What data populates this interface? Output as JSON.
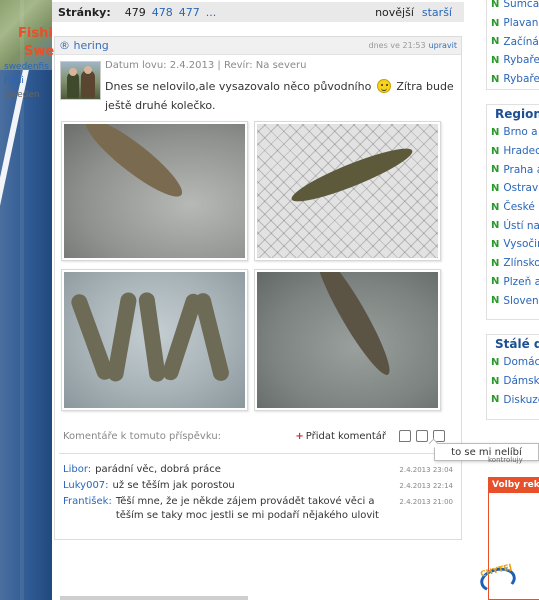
{
  "pager": {
    "label": "Stránky:",
    "current": "479",
    "pages": [
      "478",
      "477",
      "..."
    ],
    "newer": "novější",
    "older": "starší"
  },
  "post": {
    "author": "hering",
    "time": "dnes ve 21:53",
    "edit": "upravit",
    "meta": "Datum lovu: 2.4.2013 | Revír: Na severu",
    "text_before": "Dnes se nelovilo,ale vysazovalo něco původního",
    "text_after": "Zítra bude ještě druhé kolečko.",
    "comments_title": "Komentáře k tomuto příspěvku:",
    "add_comment": "Přidat komentář",
    "comments": [
      {
        "author": "Libor:",
        "text": "parádní věc, dobrá práce",
        "date": "2.4.2013 23:04"
      },
      {
        "author": "Luky007:",
        "text": "už se těším jak porostou",
        "date": "2.4.2013 22:14"
      },
      {
        "author": "František:",
        "text": "Těší mne, že je někde zájem provádět takové věci a těším se taky moc jestli se mi podaří nějakého ulovit",
        "date": "2.4.2013 21:00"
      }
    ]
  },
  "tooltip": "to se mi nelíbí",
  "sidebar": {
    "top_items": [
      "Sumcař",
      "Plavaná",
      "Začínán",
      "Rybařen",
      "Rybařen"
    ],
    "regions_title": "Region",
    "regions": [
      "Brno a o",
      "Hradec",
      "Praha a",
      "Ostrava",
      "České B",
      "Ústí nad",
      "Vysočin",
      "Zlínsko",
      "Plzeň a",
      "Slovens"
    ],
    "staly_title": "Stálé d",
    "staly": [
      "Domácí",
      "Dámská",
      "Diskuze"
    ],
    "sub_text": "kontrolujy",
    "ad_head": "Volby rekla",
    "ad_title1": "Fishi",
    "ad_title2": "Swe",
    "ad_line1": "swedenfis",
    "ad_line2": "Fishi",
    "ad_line3": "Sweden",
    "logo_text": "CHYTEJ"
  },
  "colors": {
    "link": "#2a66b8",
    "region_header": "#1d4f93",
    "bullet_green": "#2a9b2a",
    "ad_orange": "#e8502a",
    "pager_bg": "#e9e9e9"
  }
}
